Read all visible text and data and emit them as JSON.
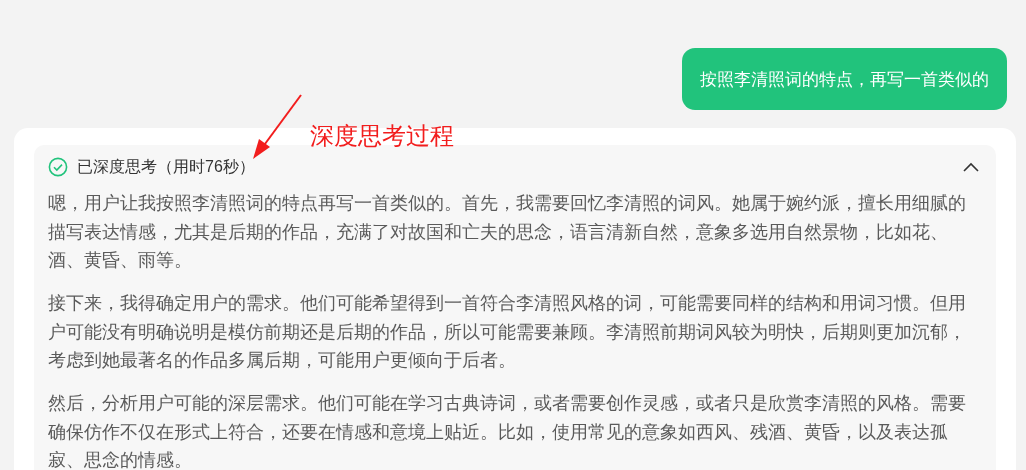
{
  "user_message": {
    "text": "按照李清照词的特点，再写一首类似的"
  },
  "annotation": {
    "text": "深度思考过程"
  },
  "thinking": {
    "title": "已深度思考（用时76秒）",
    "expanded": true,
    "done": true,
    "paragraphs": [
      "嗯，用户让我按照李清照词的特点再写一首类似的。首先，我需要回忆李清照的词风。她属于婉约派，擅长用细腻的描写表达情感，尤其是后期的作品，充满了对故国和亡夫的思念，语言清新自然，意象多选用自然景物，比如花、酒、黄昏、雨等。",
      "接下来，我得确定用户的需求。他们可能希望得到一首符合李清照风格的词，可能需要同样的结构和用词习惯。但用户可能没有明确说明是模仿前期还是后期的作品，所以可能需要兼顾。李清照前期词风较为明快，后期则更加沉郁，考虑到她最著名的作品多属后期，可能用户更倾向于后者。",
      "然后，分析用户可能的深层需求。他们可能在学习古典诗词，或者需要创作灵感，或者只是欣赏李清照的风格。需要确保仿作不仅在形式上符合，还要在情感和意境上贴近。比如，使用常见的意象如西风、残酒、黄昏，以及表达孤寂、思念的情感。"
    ]
  }
}
